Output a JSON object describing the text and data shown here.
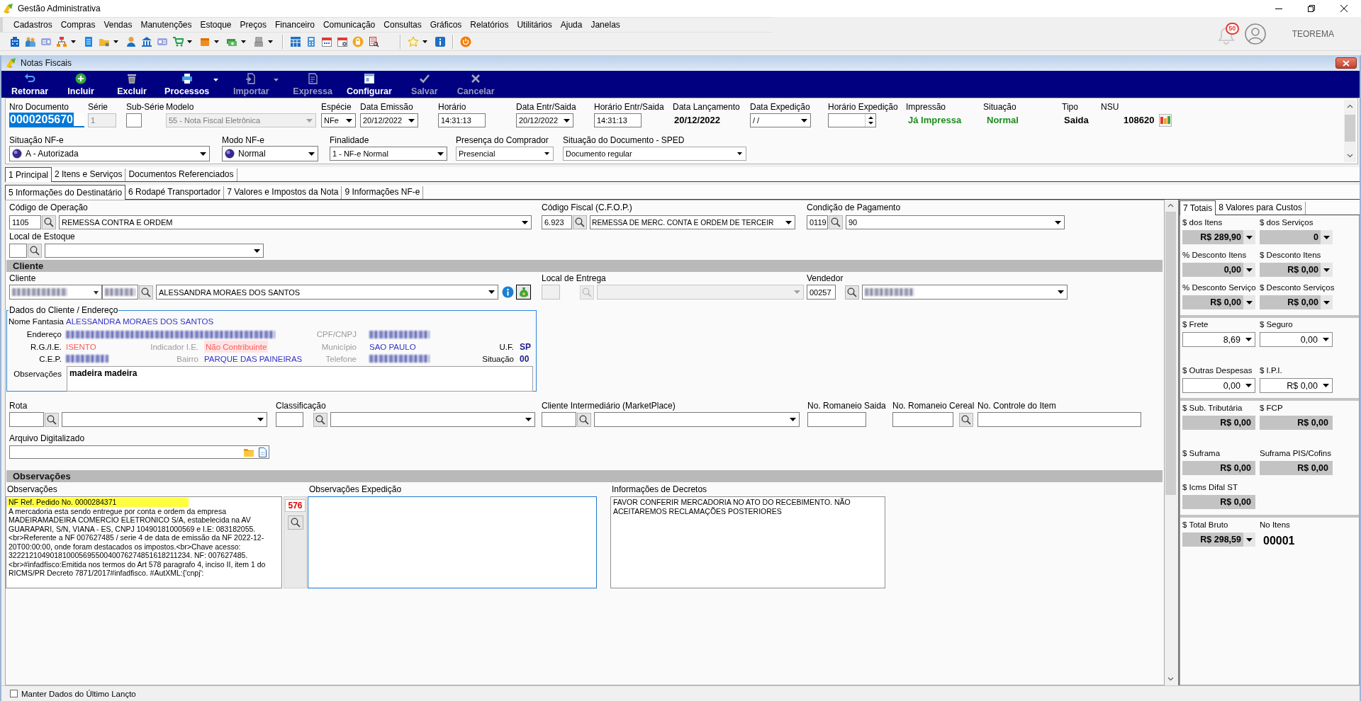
{
  "app": {
    "title": "Gestão Administrativa",
    "notifications": "50",
    "user": "TEOREMA"
  },
  "menu": [
    "Cadastros",
    "Compras",
    "Vendas",
    "Manutenções",
    "Estoque",
    "Preços",
    "Financeiro",
    "Comunicação",
    "Consultas",
    "Gráficos",
    "Relatórios",
    "Utilitários",
    "Ajuda",
    "Janelas"
  ],
  "toolbar": [
    [
      {
        "dropdown": false
      },
      {
        "dropdown": false
      },
      {
        "dropdown": false
      },
      {
        "dropdown": true
      },
      {
        "dropdown": false
      },
      {
        "dropdown": true
      },
      {
        "dropdown": false
      },
      {
        "dropdown": false
      },
      {
        "dropdown": false
      },
      {
        "dropdown": true
      },
      {
        "dropdown": true
      },
      {
        "dropdown": true
      },
      {
        "dropdown": true
      }
    ],
    [
      {
        "dropdown": false
      },
      {
        "dropdown": false
      },
      {
        "dropdown": false
      },
      {
        "dropdown": false
      },
      {
        "dropdown": false
      },
      {
        "dropdown": false
      }
    ],
    [
      {
        "dropdown": true
      },
      {
        "dropdown": false
      }
    ],
    [
      {
        "dropdown": false
      }
    ]
  ],
  "window": {
    "title": "Notas Fiscais"
  },
  "actions": [
    {
      "label": "Retornar",
      "disabled": false,
      "dropdown": false
    },
    {
      "label": "Incluir",
      "disabled": false,
      "dropdown": false
    },
    {
      "label": "Excluir",
      "disabled": false,
      "dropdown": false
    },
    {
      "label": "Processos",
      "disabled": false,
      "dropdown": true
    },
    {
      "label": "Importar",
      "disabled": true,
      "dropdown": true
    },
    {
      "label": "Expressa",
      "disabled": true,
      "dropdown": false
    },
    {
      "label": "Configurar",
      "disabled": false,
      "dropdown": false
    },
    {
      "label": "Salvar",
      "disabled": true,
      "dropdown": false
    },
    {
      "label": "Cancelar",
      "disabled": true,
      "dropdown": false
    }
  ],
  "header": {
    "document_number": {
      "label": "Nro Documento",
      "value": "0000205670",
      "selected": true
    },
    "row_1": [
      {
        "kind": "input",
        "label": "Série",
        "value": "1",
        "disabled": true
      },
      {
        "kind": "input",
        "label": "Sub-Série",
        "disabled": false
      },
      {
        "kind": "combo",
        "label": "Modelo",
        "value": "55 - Nota Fiscal Eletrônica",
        "disabled": true
      },
      {
        "kind": "combo",
        "label": "Espécie",
        "value": "NFe",
        "disabled": false
      },
      {
        "kind": "combo",
        "label": "Data Emissão",
        "value": "20/12/2022",
        "disabled": false
      },
      {
        "kind": "input",
        "label": "Horário",
        "value": "14:31:13",
        "disabled": false
      },
      {
        "kind": "combo",
        "label": "Data Entr/Saida",
        "value": "20/12/2022",
        "disabled": false
      },
      {
        "kind": "input",
        "label": "Horário Entr/Saida",
        "value": "14:31:13",
        "disabled": false
      },
      {
        "kind": "display",
        "label": "Data Lançamento",
        "value": "20/12/2022",
        "color": "#000000",
        "disabled": false
      },
      {
        "kind": "combo",
        "label": "Data Expedição",
        "value": "/ /",
        "disabled": false
      },
      {
        "kind": "spin",
        "label": "Horário Expedição",
        "disabled": false
      },
      {
        "kind": "display",
        "label": "Impressão",
        "value": "Já Impressa",
        "color": "#1e8c1e",
        "disabled": false
      },
      {
        "kind": "display",
        "label": "Situação",
        "value": "Normal",
        "color": "#1e8c1e",
        "disabled": false
      },
      {
        "kind": "display",
        "label": "Tipo",
        "value": "Saida",
        "color": "#000000",
        "disabled": false
      },
      {
        "kind": "nsu",
        "label": "NSU",
        "value": "108620",
        "color": "#000000",
        "disabled": false
      }
    ],
    "row_2": [
      {
        "kind": "status",
        "label": "Situação NF-e",
        "value": "A - Autorizada"
      },
      {
        "kind": "status",
        "label": "Modo NF-e",
        "value": "Normal"
      },
      {
        "kind": "combo",
        "label": "Finalidade",
        "value": "1 - NF-e Normal"
      },
      {
        "kind": "flat",
        "label": "Presença do Comprador",
        "value": "Presencial"
      },
      {
        "kind": "flat",
        "label": "Situação do Documento - SPED",
        "value": "Documento regular"
      }
    ]
  },
  "tabs": [
    {
      "label": "1 Principal",
      "selected": true
    },
    {
      "label": "2 Itens e Serviços",
      "selected": false
    },
    {
      "label": "Documentos Referenciados",
      "selected": false
    }
  ],
  "subtabs": [
    {
      "label": "5 Informações do Destinatário",
      "selected": true
    },
    {
      "label": "6 Rodapé Transportador",
      "selected": false
    },
    {
      "label": "7 Valores e Impostos da Nota",
      "selected": false
    },
    {
      "label": "9 Informações NF-e",
      "selected": false
    }
  ],
  "destinatario": {
    "operacao": {
      "label": "Código de Operação",
      "code": "1105",
      "value": "REMESSA CONTRA E ORDEM"
    },
    "cfop": {
      "label": "Código Fiscal (C.F.O.P.)",
      "code": "6.923",
      "value": "REMESSA DE MERC. CONTA E ORDEM DE TERCEIR"
    },
    "pagamento": {
      "label": "Condição de Pagamento",
      "code": "0119",
      "value": "90"
    },
    "estoque": {
      "label": "Local de Estoque"
    },
    "cliente_section": "Cliente",
    "cliente": {
      "label": "Cliente",
      "document": {
        "blurred": true
      },
      "code": {
        "blurred": true
      },
      "name": "ALESSANDRA MORAES DOS SANTOS"
    },
    "entrega": {
      "label": "Local de Entrega",
      "disabled": true
    },
    "vendedor": {
      "label": "Vendedor",
      "code": "00257",
      "name": {
        "blurred": true
      }
    },
    "dados": {
      "title": "Dados do Cliente / Endereço",
      "nome_fantasia": {
        "label": "Nome Fantasia",
        "value": "ALESSANDRA MORAES DOS SANTOS",
        "color": "#3434c8"
      },
      "endereco": {
        "label": "Endereço",
        "value": {
          "blurred": true
        }
      },
      "cpf_cnpj": {
        "label": "CPF/CNPJ",
        "value": {
          "blurred": true
        }
      },
      "rg_ie": {
        "label": "R.G./I.E.",
        "value": "ISENTO",
        "color": "#ff5a5a"
      },
      "indicador_ie": {
        "label": "Indicador I.E.",
        "value": "Não Contribuinte",
        "color": "#ff5a5a"
      },
      "municipio": {
        "label": "Município",
        "value": "SAO PAULO",
        "color": "#3434c8"
      },
      "uf": {
        "label": "U.F.",
        "value": "SP",
        "color": "#1c1c8c"
      },
      "cep": {
        "label": "C.E.P.",
        "value": {
          "blurred": true
        }
      },
      "bairro": {
        "label": "Bairro",
        "value": "PARQUE DAS PAINEIRAS",
        "color": "#3434c8"
      },
      "telefone": {
        "label": "Telefone",
        "value": {
          "blurred": true
        }
      },
      "situacao": {
        "label": "Situação",
        "value": "00",
        "color": "#1c1c8c"
      },
      "observacoes": {
        "label": "Observações",
        "value": "madeira madeira"
      }
    },
    "rota": {
      "label": "Rota"
    },
    "classificacao": {
      "label": "Classificação"
    },
    "intermediario": {
      "label": "Cliente Intermediário (MarketPlace)"
    },
    "romaneio_saida": {
      "label": "No. Romaneio Saida"
    },
    "romaneio_cereal": {
      "label": "No. Romaneio Cereal"
    },
    "controle_item": {
      "label": "No. Controle do Item"
    },
    "arquivo": {
      "label": "Arquivo Digitalizado"
    }
  },
  "observacoes_section": {
    "title": "Observações",
    "notes": {
      "label": "Observações",
      "counter": "576",
      "focused": false,
      "lines": [
        {
          "text": "NF Ref. Pedido No. 0000284371",
          "highlighted": true
        },
        {
          "text": "A mercadoria esta sendo entregue por conta e ordem da empresa MADEIRAMADEIRA COMERCIO ELETRONICO S/A, estabelecida na AV GUARAPARI, S/N, VIANA - ES, CNPJ 10490181000569 e I.E: 083182055.<br>Referente a NF 007627485 / serie 4 de data de emissão da NF 2022-12-20T00:00:00, onde foram destacados os impostos.<br>Chave acesso: 32221210490181000569550040076274851618211234. NF: 007627485.<br>#infadfisco:Emitida nos termos do Art 578 paragrafo 4, inciso II, item 1 do RICMS/PR Decreto 7871/2017#infadfisco. #AutXML:{'cnpj':",
          "highlighted": false
        }
      ]
    },
    "expedicao": {
      "label": "Observações Expedição",
      "focused": true
    },
    "decretos": {
      "label": "Informações de Decretos",
      "text": "FAVOR CONFERIR MERCADORIA NO ATO DO RECEBIMENTO. NÃO ACEITAREMOS RECLAMAÇÕES POSTERIORES",
      "focused": false
    }
  },
  "totals": {
    "tabs": [
      {
        "label": "7 Totais",
        "selected": true
      },
      {
        "label": "8 Valores para Custos",
        "selected": false
      }
    ],
    "groups": [
      [
        {
          "label": "$ dos Itens",
          "value": "R$ 289,90",
          "kind": "readonly",
          "dropdown": true
        },
        {
          "label": "$ dos Serviços",
          "value": "0",
          "kind": "readonly",
          "dropdown": true
        },
        {
          "label": "% Desconto Itens",
          "value": "0,00",
          "kind": "readonly",
          "dropdown": true
        },
        {
          "label": "$ Desconto Itens",
          "value": "R$ 0,00",
          "kind": "readonly",
          "dropdown": true
        },
        {
          "label": "% Desconto Serviço",
          "value": "R$ 0,00",
          "kind": "readonly",
          "dropdown": true
        },
        {
          "label": "$ Desconto Serviços",
          "value": "R$ 0,00",
          "kind": "readonly",
          "dropdown": true
        }
      ],
      [
        {
          "label": "$ Frete",
          "value": "8,69",
          "kind": "input",
          "dropdown": true
        },
        {
          "label": "$ Seguro",
          "value": "0,00",
          "kind": "input",
          "dropdown": true
        },
        {
          "label": "$ Outras Despesas",
          "value": "0,00",
          "kind": "input",
          "dropdown": true
        },
        {
          "label": "$ I.P.I.",
          "value": "R$ 0,00",
          "kind": "input",
          "dropdown": true
        }
      ],
      [
        {
          "label": "$ Sub. Tributária",
          "value": "R$ 0,00",
          "kind": "readonly",
          "dropdown": false
        },
        {
          "label": "$ FCP",
          "value": "R$ 0,00",
          "kind": "readonly",
          "dropdown": false
        },
        {
          "label": "$ Suframa",
          "value": "R$ 0,00",
          "kind": "readonly",
          "dropdown": false
        },
        {
          "label": "Suframa PIS/Cofins",
          "value": "R$ 0,00",
          "kind": "readonly",
          "dropdown": false
        },
        {
          "label": "$ Icms Difal ST",
          "value": "R$ 0,00",
          "kind": "readonly",
          "dropdown": false
        }
      ],
      [
        {
          "label": "$ Total Bruto",
          "value": "R$ 298,59",
          "kind": "readonly",
          "dropdown": true
        },
        {
          "label": "No Itens",
          "value": "00001",
          "kind": "count"
        }
      ]
    ]
  },
  "footer": {
    "label": "Manter Dados do Último Lançto",
    "checked": false
  }
}
